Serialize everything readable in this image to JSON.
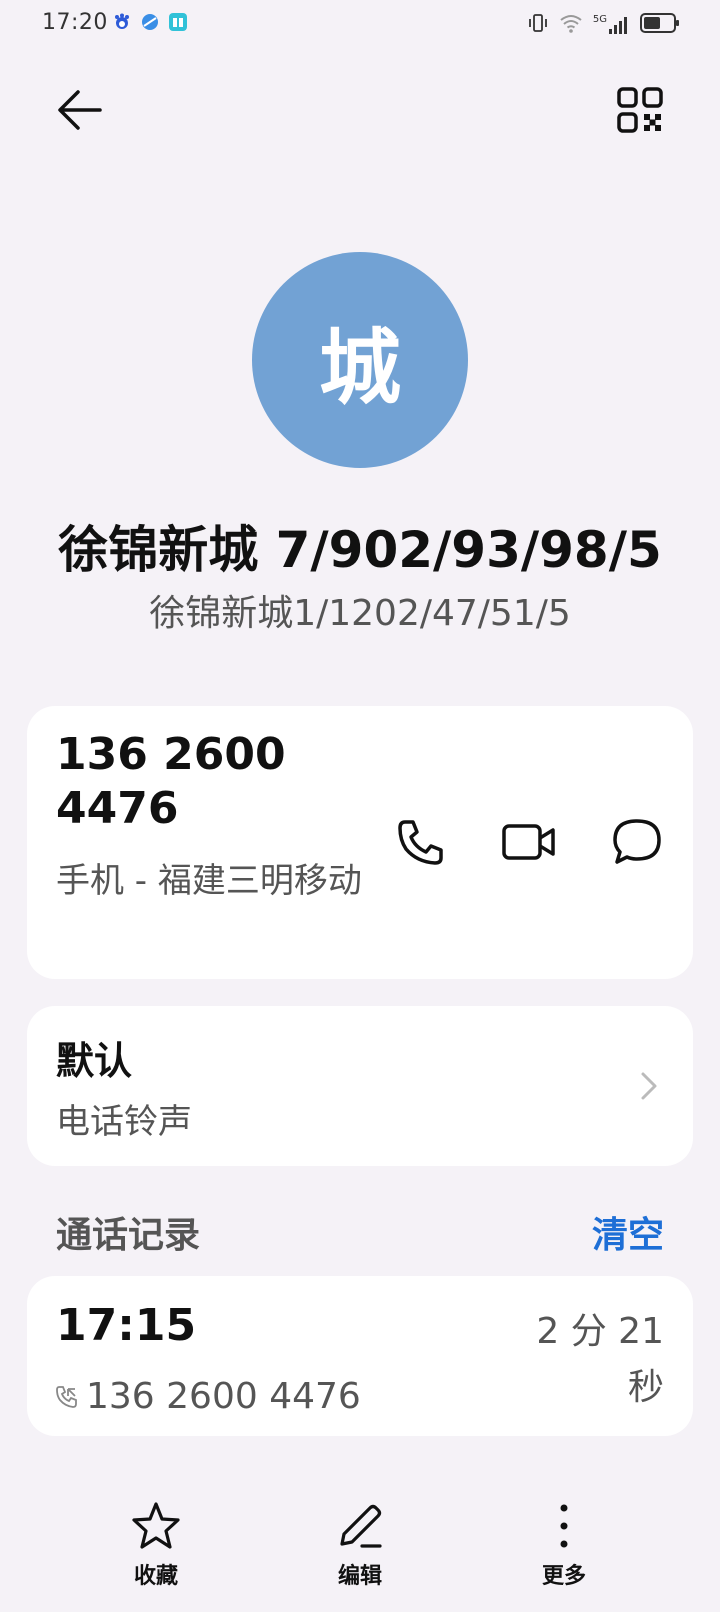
{
  "status_bar": {
    "time": "17:20",
    "network_label": "5G",
    "icons": [
      "baidu-icon",
      "browser-icon",
      "book-app-icon",
      "vibrate-icon",
      "wifi-icon",
      "signal-icon",
      "battery-icon"
    ]
  },
  "header": {
    "back_icon": "arrow-left-icon",
    "qr_icon": "qr-code-icon"
  },
  "contact": {
    "avatar_char": "城",
    "avatar_color": "#72a2d4",
    "name": "徐锦新城 7/902/93/98/5",
    "subname": "徐锦新城1/1202/47/51/5"
  },
  "phone": {
    "number": "136 2600 4476",
    "type": "手机 - 福建三明移动",
    "actions": [
      "phone-icon",
      "video-call-icon",
      "message-icon"
    ]
  },
  "ringtone": {
    "value": "默认",
    "label": "电话铃声"
  },
  "history": {
    "title": "通话记录",
    "clear_label": "清空",
    "accent_color": "#1e6fd6",
    "entries": [
      {
        "time": "17:15",
        "number": "136 2600 4476",
        "duration": "2 分 21 秒"
      }
    ]
  },
  "bottom_bar": {
    "favorite_label": "收藏",
    "edit_label": "编辑",
    "more_label": "更多"
  }
}
